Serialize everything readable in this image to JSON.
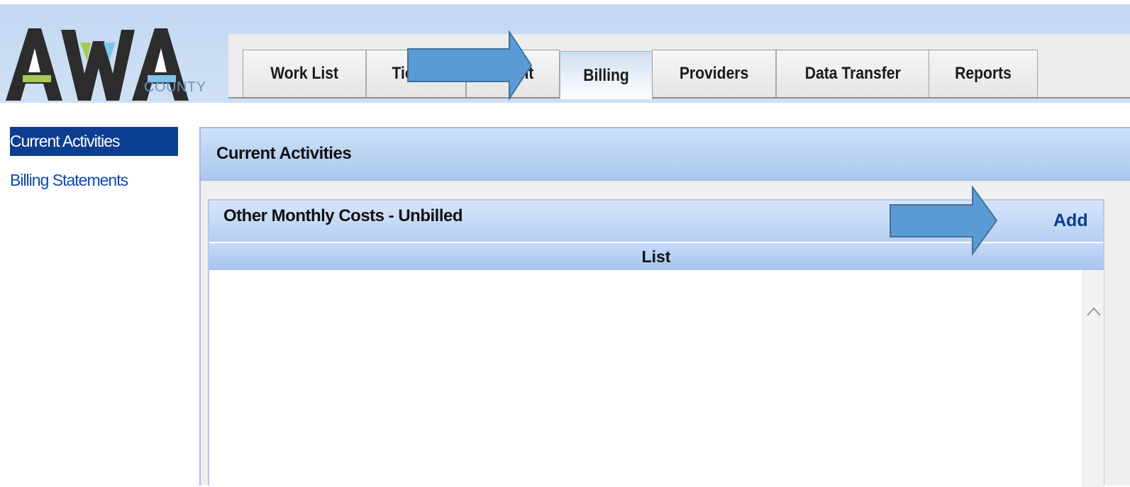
{
  "logo": {
    "main_text": "AWA",
    "sub_text": "COUNTY"
  },
  "tabs": [
    {
      "label": "Work List",
      "active": false
    },
    {
      "label": "Tickler",
      "active": false
    },
    {
      "label": "Client",
      "active": false
    },
    {
      "label": "Billing",
      "active": true
    },
    {
      "label": "Providers",
      "active": false
    },
    {
      "label": "Data Transfer",
      "active": false
    },
    {
      "label": "Reports",
      "active": false
    }
  ],
  "sidebar": {
    "items": [
      {
        "label": "Current Activities",
        "active": true
      },
      {
        "label": "Billing Statements",
        "active": false
      }
    ]
  },
  "panel": {
    "title": "Current Activities",
    "section": {
      "title": "Other Monthly Costs - Unbilled",
      "add_label": "Add",
      "list_header": "List"
    }
  },
  "annotations": {
    "arrow_color": "#5b9bd5",
    "arrow_outline": "#41719c"
  },
  "colors": {
    "accent_dark_blue": "#0b3d91",
    "link_blue": "#1049b0",
    "header_blue": "#aac8ee"
  }
}
